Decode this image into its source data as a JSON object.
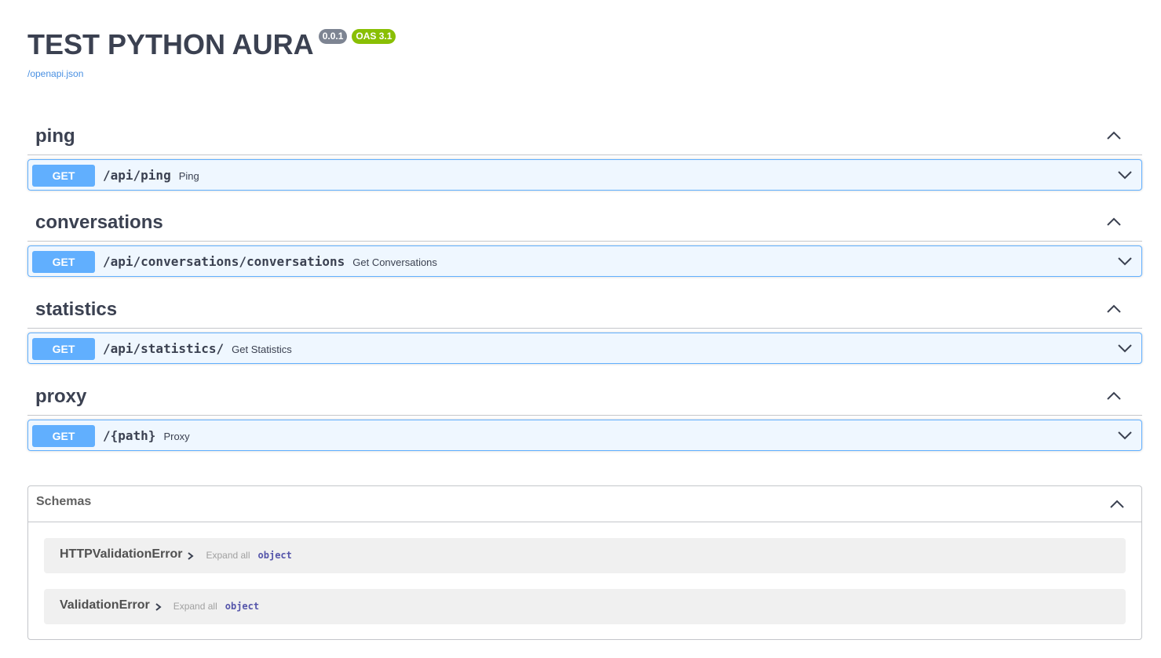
{
  "info": {
    "title": "TEST PYTHON AURA",
    "version": "0.0.1",
    "oas_version": "OAS 3.1",
    "spec_url": "/openapi.json"
  },
  "tags": [
    {
      "name": "ping",
      "operations": [
        {
          "method": "GET",
          "path": "/api/ping",
          "summary": "Ping"
        }
      ]
    },
    {
      "name": "conversations",
      "operations": [
        {
          "method": "GET",
          "path": "/api/conversations/conversations",
          "summary": "Get Conversations"
        }
      ]
    },
    {
      "name": "statistics",
      "operations": [
        {
          "method": "GET",
          "path": "/api/statistics/",
          "summary": "Get Statistics"
        }
      ]
    },
    {
      "name": "proxy",
      "operations": [
        {
          "method": "GET",
          "path": "/{path}",
          "summary": "Proxy"
        }
      ]
    }
  ],
  "schemas": {
    "title": "Schemas",
    "models": [
      {
        "name": "HTTPValidationError",
        "expand_label": "Expand all",
        "type": "object"
      },
      {
        "name": "ValidationError",
        "expand_label": "Expand all",
        "type": "object"
      }
    ]
  },
  "colors": {
    "get_method": "#61affe",
    "version_badge": "#7d8492",
    "oas_badge": "#89bf04",
    "link": "#4990e2"
  },
  "icons": {
    "tag_toggle": "chevron-up-icon",
    "op_toggle": "chevron-down-icon",
    "model_expand": "chevron-right-icon"
  }
}
